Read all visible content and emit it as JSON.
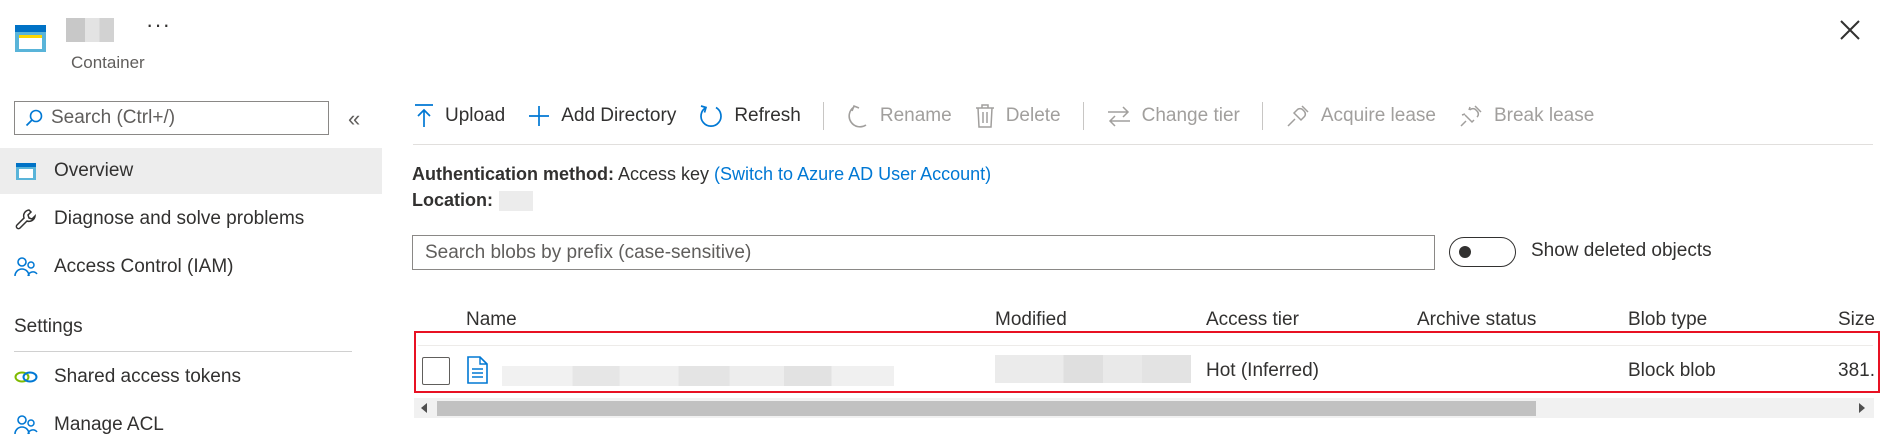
{
  "header": {
    "more_label": "···",
    "subtitle": "Container"
  },
  "sidebar": {
    "search_placeholder": "Search (Ctrl+/)",
    "collapse_label": "«",
    "items": [
      {
        "label": "Overview",
        "icon": "container-icon",
        "active": true
      },
      {
        "label": "Diagnose and solve problems",
        "icon": "wrench-icon"
      },
      {
        "label": "Access Control (IAM)",
        "icon": "people-icon"
      }
    ],
    "settings_heading": "Settings",
    "settings_items": [
      {
        "label": "Shared access tokens",
        "icon": "link-icon"
      },
      {
        "label": "Manage ACL",
        "icon": "people-icon"
      }
    ]
  },
  "toolbar": {
    "upload": "Upload",
    "add_directory": "Add Directory",
    "refresh": "Refresh",
    "rename": "Rename",
    "delete": "Delete",
    "change_tier": "Change tier",
    "acquire_lease": "Acquire lease",
    "break_lease": "Break lease"
  },
  "info": {
    "auth_label": "Authentication method:",
    "auth_value": "Access key",
    "auth_link": "(Switch to Azure AD User Account)",
    "location_label": "Location:"
  },
  "blob_search": {
    "placeholder": "Search blobs by prefix (case-sensitive)"
  },
  "toggle": {
    "label": "Show deleted objects",
    "on": false
  },
  "table": {
    "columns": [
      "Name",
      "Modified",
      "Access tier",
      "Archive status",
      "Blob type",
      "Size"
    ],
    "rows": [
      {
        "access_tier": "Hot (Inferred)",
        "archive_status": "",
        "blob_type": "Block blob",
        "size": "381."
      }
    ]
  },
  "colors": {
    "accent": "#0078d4",
    "highlight_border": "#e81123",
    "active_bg": "#ededed"
  }
}
